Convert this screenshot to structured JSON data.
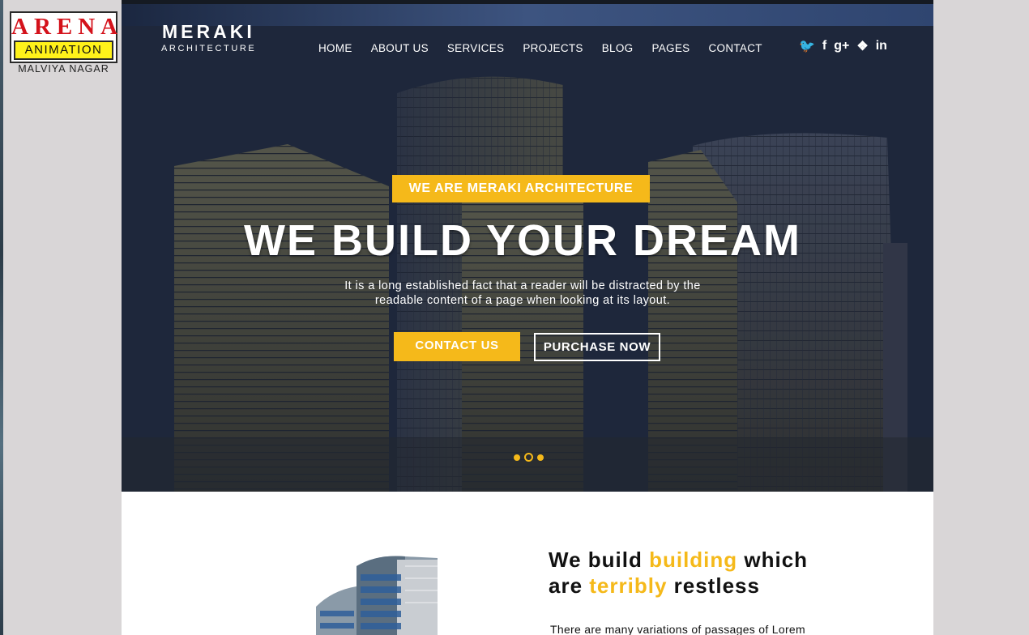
{
  "badge": {
    "top": "ARENA",
    "middle": "ANIMATION",
    "bottom": "MALVIYA NAGAR"
  },
  "logo": {
    "title": "MERAKI",
    "subtitle": "ARCHITECTURE"
  },
  "nav": {
    "items": [
      "HOME",
      "ABOUT US",
      "SERVICES",
      "PROJECTS",
      "BLOG",
      "PAGES",
      "CONTACT"
    ]
  },
  "social": {
    "icons": [
      "twitter-icon",
      "facebook-icon",
      "google-plus-icon",
      "dropbox-icon",
      "linkedin-icon"
    ],
    "glyphs": [
      "🐦",
      "f",
      "g+",
      "❖",
      "in"
    ]
  },
  "hero": {
    "tagline": "WE ARE MERAKI ARCHITECTURE",
    "headline": "WE BUILD YOUR DREAM",
    "subtext_line1": "It is a long established fact that a reader will be distracted by the",
    "subtext_line2": "readable content of a page when looking at its layout.",
    "contact_label": "CONTACT US",
    "purchase_label": "PURCHASE NOW",
    "slides": 3,
    "active_slide": 2
  },
  "about": {
    "title_p1": "We build ",
    "title_hl1": "building",
    "title_p2": " which",
    "title_p3": "are ",
    "title_hl2": "terribly",
    "title_p4": " restless",
    "text": "There are many variations of passages of Lorem"
  },
  "colors": {
    "accent": "#f5b91a",
    "white": "#ffffff",
    "dark": "#111111"
  }
}
